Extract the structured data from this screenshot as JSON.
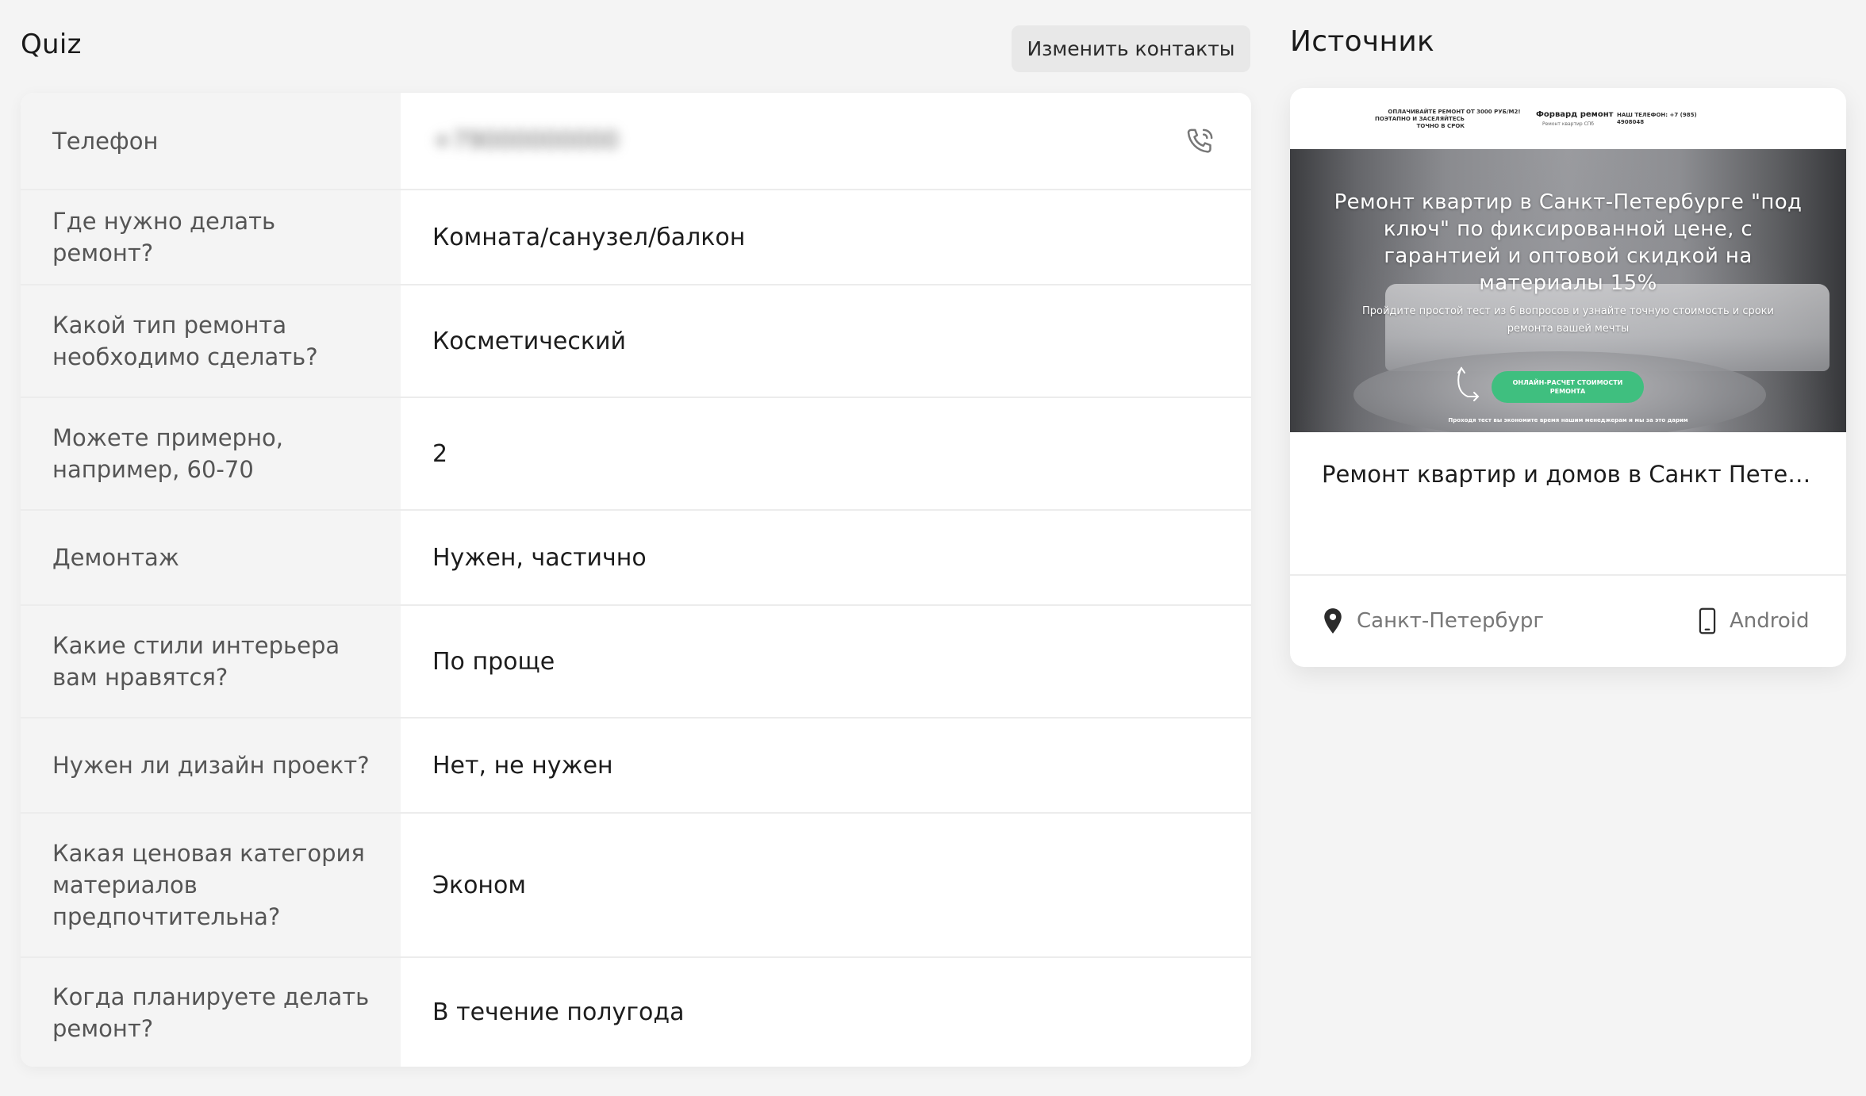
{
  "quiz": {
    "title": "Quiz",
    "edit_contacts_label": "Изменить контакты",
    "rows": [
      {
        "label": "Телефон",
        "value": "+79000000000"
      },
      {
        "label": "Где нужно делать ремонт?",
        "value": "Комната/санузел/балкон"
      },
      {
        "label": "Какой тип ремонта необходимо сделать?",
        "value": "Косметический"
      },
      {
        "label": "Можете примерно, например, 60-70",
        "value": "2"
      },
      {
        "label": "Демонтаж",
        "value": "Нужен, частично"
      },
      {
        "label": "Какие стили интерьера вам нравятся?",
        "value": "По проще"
      },
      {
        "label": "Нужен ли дизайн проект?",
        "value": "Нет, не нужен"
      },
      {
        "label": "Какая ценовая категория материалов предпочтительна?",
        "value": "Эконом"
      },
      {
        "label": "Когда планируете делать ремонт?",
        "value": "В течение полугода"
      }
    ]
  },
  "source": {
    "title": "Источник",
    "preview": {
      "header_left": "ОПЛАЧИВАЙТЕ РЕМОНТ ПОЭТАПНО И ЗАСЕЛЯЙТЕСЬ ТОЧНО В СРОК",
      "header_price": "ОТ 3000 РУБ/М2!",
      "header_logo": "Форвард ремонт",
      "header_logo_sub": "Ремонт квартир СПб",
      "header_phone": "НАШ ТЕЛЕФОН: +7 (985) 4908048",
      "hero_title": "Ремонт квартир в Санкт-Петербурге \"под ключ\" по фиксированной цене, с гарантией и оптовой скидкой на материалы 15%",
      "hero_subtitle": "Пройдите простой тест из 6 вопросов и узнайте точную стоимость и сроки ремонта вашей мечты",
      "hero_button": "ОНЛАЙН-РАСЧЕТ СТОИМОСТИ РЕМОНТА",
      "hero_footer": "Проходя тест вы экономите время нашим менеджерам и мы за это дарим"
    },
    "name": "Ремонт квартир и домов в Санкт Петербурге",
    "city": "Санкт-Петербург",
    "platform": "Android"
  },
  "colors": {
    "background": "#f4f4f4",
    "card": "#ffffff",
    "label_cell": "#f4f4f4",
    "accent_green": "#3fbf7f"
  }
}
